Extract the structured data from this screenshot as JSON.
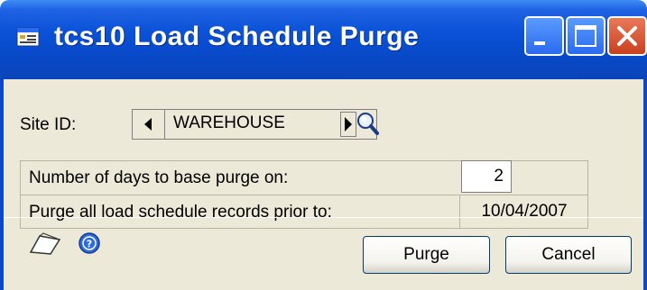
{
  "window": {
    "title": "tcs10 Load Schedule Purge",
    "icons": {
      "app": "window-app-icon",
      "minimize": "minimize-icon",
      "maximize": "maximize-icon",
      "close": "close-icon"
    }
  },
  "site": {
    "label": "Site ID:",
    "value": "WAREHOUSE"
  },
  "purge": {
    "days_label": "Number of days to base purge on:",
    "days_value": "2",
    "prior_label": "Purge all load schedule records prior to:",
    "prior_date": "10/04/2007"
  },
  "buttons": {
    "purge": "Purge",
    "cancel": "Cancel"
  },
  "colors": {
    "titlebar": "#0a52d8",
    "face": "#ece9d8",
    "close": "#c9401e"
  }
}
